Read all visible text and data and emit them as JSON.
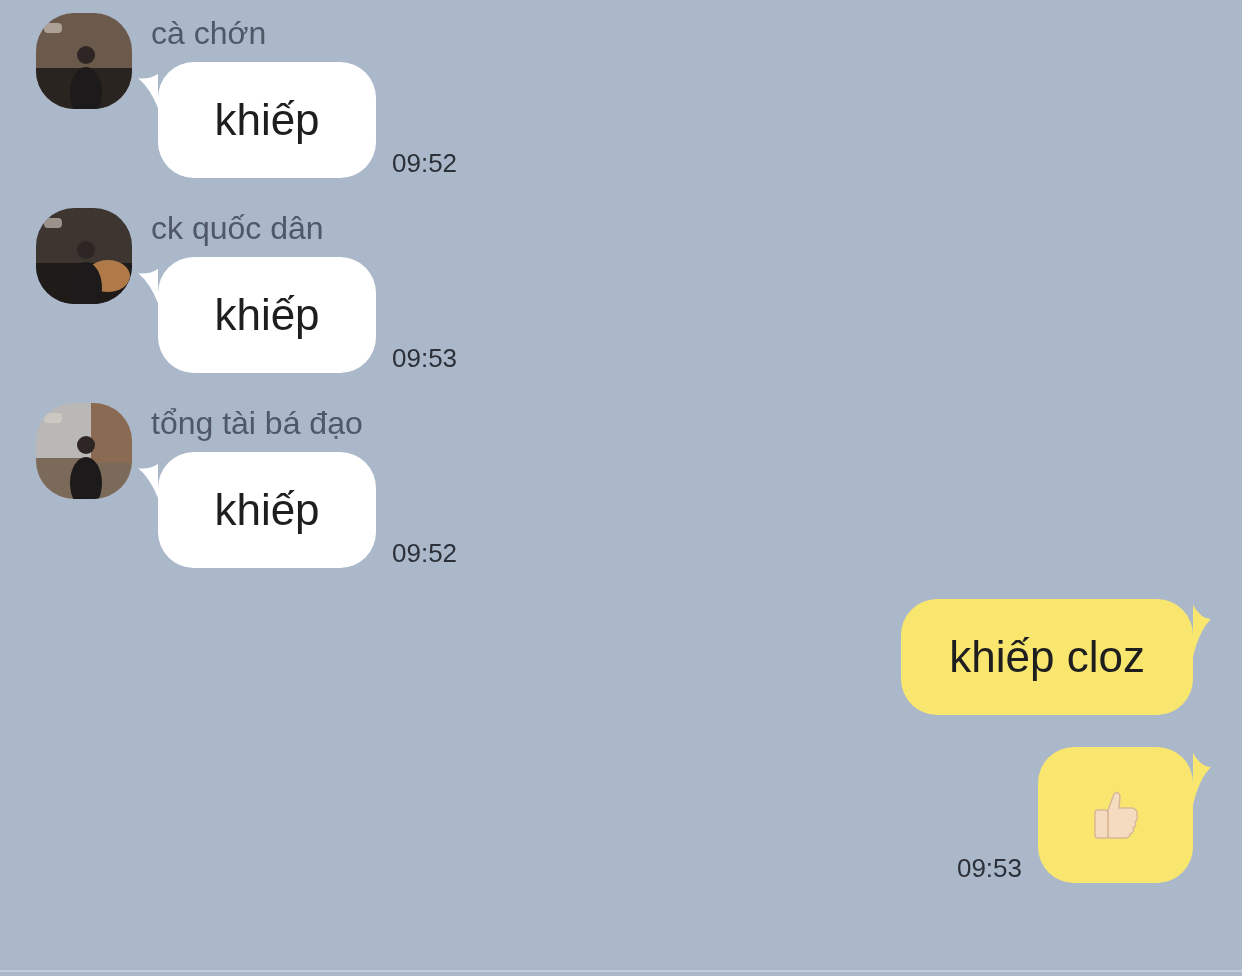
{
  "messages": [
    {
      "kind": "incoming",
      "sender": "cà chớn",
      "text": "khiếp",
      "time": "09:52"
    },
    {
      "kind": "incoming",
      "sender": "ck quốc dân",
      "text": "khiếp",
      "time": "09:53"
    },
    {
      "kind": "incoming",
      "sender": "tổng tài bá đạo",
      "text": "khiếp",
      "time": "09:52"
    },
    {
      "kind": "outgoing",
      "text": "khiếp cloz"
    },
    {
      "kind": "outgoing_thumbs_up",
      "time": "09:53"
    }
  ]
}
